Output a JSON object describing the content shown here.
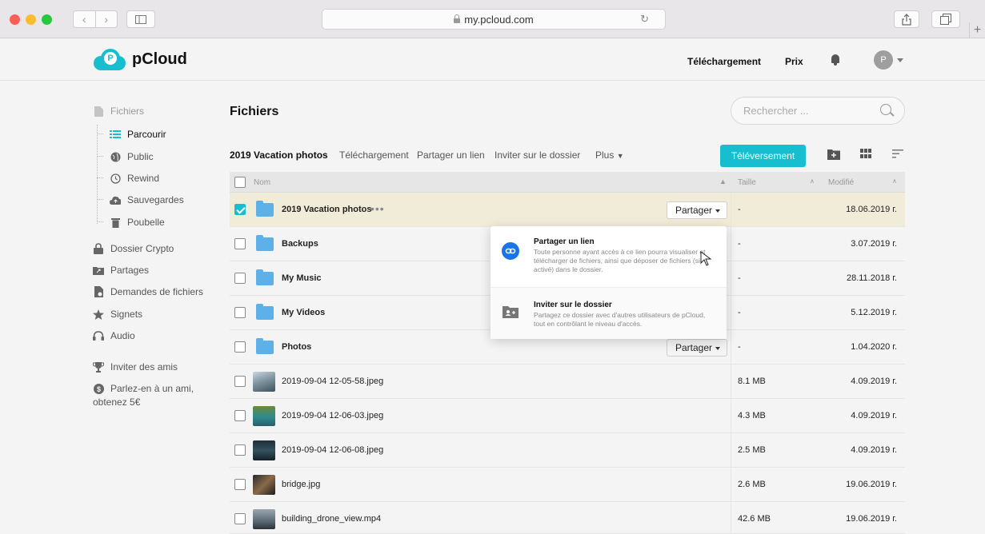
{
  "browser": {
    "url": "my.pcloud.com",
    "tabs_new": "+"
  },
  "header": {
    "logo_text": "pCloud",
    "logo_mark": "P",
    "links": [
      "Téléchargement",
      "Prix"
    ],
    "avatar_initial": "P"
  },
  "sidebar": {
    "items": [
      {
        "label": "Fichiers",
        "icon": "file-icon"
      },
      {
        "label": "Parcourir",
        "icon": "list-icon"
      },
      {
        "label": "Public",
        "icon": "globe-icon"
      },
      {
        "label": "Rewind",
        "icon": "history-icon"
      },
      {
        "label": "Sauvegardes",
        "icon": "cloud-upload-icon"
      },
      {
        "label": "Poubelle",
        "icon": "trash-icon"
      },
      {
        "label": "Dossier Crypto",
        "icon": "lock-icon"
      },
      {
        "label": "Partages",
        "icon": "shared-folder-icon"
      },
      {
        "label": "Demandes de fichiers",
        "icon": "file-request-icon"
      },
      {
        "label": "Signets",
        "icon": "star-icon"
      },
      {
        "label": "Audio",
        "icon": "headphones-icon"
      },
      {
        "label": "Inviter des amis",
        "icon": "trophy-icon"
      },
      {
        "label": "Parlez-en à un ami,",
        "icon": "coin-icon"
      },
      {
        "label": "obtenez 5€",
        "icon": ""
      }
    ]
  },
  "main": {
    "title": "Fichiers",
    "search_placeholder": "Rechercher ...",
    "toolbar": {
      "selected_name": "2019 Vacation photos",
      "download": "Téléchargement",
      "share_link": "Partager un lien",
      "invite": "Inviter sur le dossier",
      "more": "Plus",
      "upload": "Téléversement"
    },
    "columns": {
      "name": "Nom",
      "size": "Taille",
      "modified": "Modifié"
    },
    "share_label": "Partager",
    "rows": [
      {
        "name": "2019 Vacation photos",
        "type": "folder",
        "size": "-",
        "date": "18.06.2019 г.",
        "selected": true
      },
      {
        "name": "Backups",
        "type": "folder",
        "size": "-",
        "date": "3.07.2019 г.",
        "selected": false
      },
      {
        "name": "My Music",
        "type": "folder",
        "size": "-",
        "date": "28.11.2018 г.",
        "selected": false
      },
      {
        "name": "My Videos",
        "type": "folder",
        "size": "-",
        "date": "5.12.2019 г.",
        "selected": false
      },
      {
        "name": "Photos",
        "type": "folder",
        "size": "-",
        "date": "1.04.2020 г.",
        "selected": false
      },
      {
        "name": "2019-09-04 12-05-58.jpeg",
        "type": "image",
        "size": "8.1 MB",
        "date": "4.09.2019 г.",
        "selected": false
      },
      {
        "name": "2019-09-04 12-06-03.jpeg",
        "type": "image",
        "size": "4.3 MB",
        "date": "4.09.2019 г.",
        "selected": false
      },
      {
        "name": "2019-09-04 12-06-08.jpeg",
        "type": "image",
        "size": "2.5 MB",
        "date": "4.09.2019 г.",
        "selected": false
      },
      {
        "name": "bridge.jpg",
        "type": "image",
        "size": "2.6 MB",
        "date": "19.06.2019 г.",
        "selected": false
      },
      {
        "name": "building_drone_view.mp4",
        "type": "video",
        "size": "42.6 MB",
        "date": "19.06.2019 г.",
        "selected": false
      }
    ],
    "popup": {
      "link_title": "Partager un lien",
      "link_desc": "Toute personne ayant accès à ce lien pourra visualiser et télécharger de fichiers, ainsi que déposer de fichiers (si activé) dans le dossier.",
      "invite_title": "Inviter sur le dossier",
      "invite_desc": "Partagez ce dossier avec d'autres utilisateurs de pCloud, tout en contrôlant le niveau d'accès."
    }
  },
  "colors": {
    "accent": "#17bed0",
    "folder": "#5eb0e8",
    "selected_row": "#f1ecd8"
  }
}
